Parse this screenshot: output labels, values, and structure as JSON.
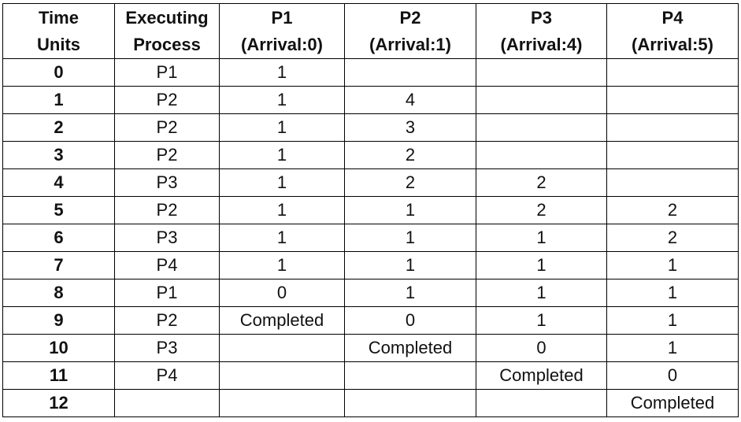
{
  "table": {
    "headers": [
      {
        "line1": "Time",
        "line2": "Units"
      },
      {
        "line1": "Executing",
        "line2": "Process"
      },
      {
        "line1": "P1",
        "line2": "(Arrival:0)"
      },
      {
        "line1": "P2",
        "line2": "(Arrival:1)"
      },
      {
        "line1": "P3",
        "line2": "(Arrival:4)"
      },
      {
        "line1": "P4",
        "line2": "(Arrival:5)"
      }
    ],
    "rows": [
      {
        "time": "0",
        "process": "P1",
        "p1": "1",
        "p2": "",
        "p3": "",
        "p4": ""
      },
      {
        "time": "1",
        "process": "P2",
        "p1": "1",
        "p2": "4",
        "p3": "",
        "p4": ""
      },
      {
        "time": "2",
        "process": "P2",
        "p1": "1",
        "p2": "3",
        "p3": "",
        "p4": ""
      },
      {
        "time": "3",
        "process": "P2",
        "p1": "1",
        "p2": "2",
        "p3": "",
        "p4": ""
      },
      {
        "time": "4",
        "process": "P3",
        "p1": "1",
        "p2": "2",
        "p3": "2",
        "p4": ""
      },
      {
        "time": "5",
        "process": "P2",
        "p1": "1",
        "p2": "1",
        "p3": "2",
        "p4": "2"
      },
      {
        "time": "6",
        "process": "P3",
        "p1": "1",
        "p2": "1",
        "p3": "1",
        "p4": "2"
      },
      {
        "time": "7",
        "process": "P4",
        "p1": "1",
        "p2": "1",
        "p3": "1",
        "p4": "1"
      },
      {
        "time": "8",
        "process": "P1",
        "p1": "0",
        "p2": "1",
        "p3": "1",
        "p4": "1"
      },
      {
        "time": "9",
        "process": "P2",
        "p1": "Completed",
        "p2": "0",
        "p3": "1",
        "p4": "1"
      },
      {
        "time": "10",
        "process": "P3",
        "p1": "",
        "p2": "Completed",
        "p3": "0",
        "p4": "1"
      },
      {
        "time": "11",
        "process": "P4",
        "p1": "",
        "p2": "",
        "p3": "Completed",
        "p4": "0"
      },
      {
        "time": "12",
        "process": "",
        "p1": "",
        "p2": "",
        "p3": "",
        "p4": "Completed"
      }
    ]
  }
}
